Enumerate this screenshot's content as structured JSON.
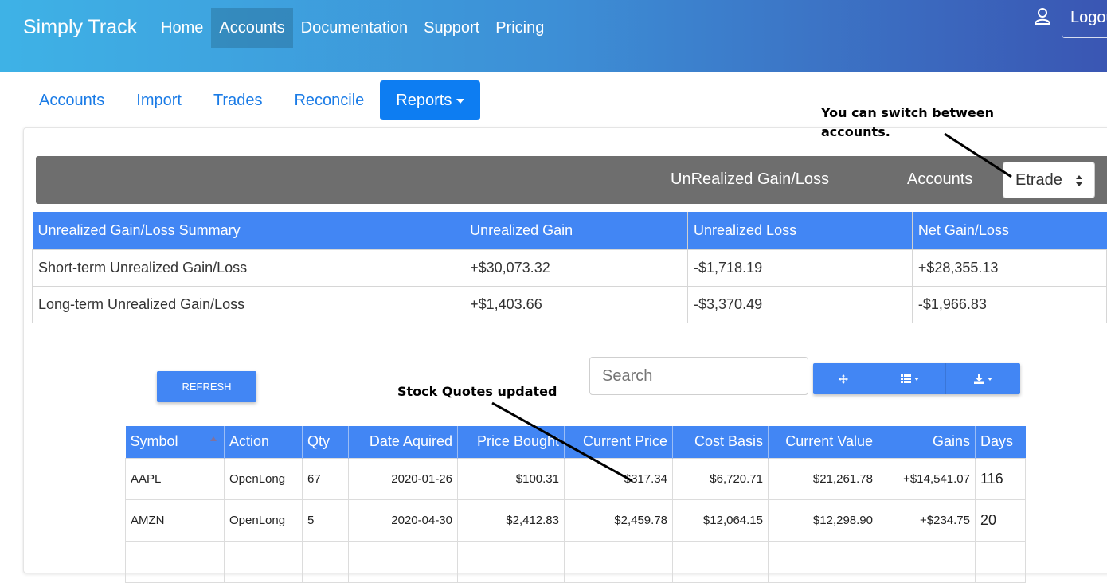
{
  "header": {
    "brand": "Simply Track",
    "nav": [
      {
        "label": "Home",
        "active": false
      },
      {
        "label": "Accounts",
        "active": true
      },
      {
        "label": "Documentation",
        "active": false
      },
      {
        "label": "Support",
        "active": false
      },
      {
        "label": "Pricing",
        "active": false
      }
    ],
    "user_icon": "user-icon",
    "logout_label": "Logout"
  },
  "subnav": {
    "items": [
      "Accounts",
      "Import",
      "Trades",
      "Reconcile"
    ],
    "reports_label": "Reports"
  },
  "annotations": {
    "switch_accounts": "You can switch between accounts.",
    "quotes_updated": "Stock Quotes updated"
  },
  "toolbar": {
    "title": "UnRealized Gain/Loss",
    "accounts_label": "Accounts",
    "account_selected": "Etrade"
  },
  "summary": {
    "headers": [
      "Unrealized Gain/Loss Summary",
      "Unrealized Gain",
      "Unrealized Loss",
      "Net Gain/Loss"
    ],
    "rows": [
      {
        "label": "Short-term Unrealized Gain/Loss",
        "gain": "+$30,073.32",
        "loss": "-$1,718.19",
        "net": "+$28,355.13",
        "net_color": "green"
      },
      {
        "label": "Long-term Unrealized Gain/Loss",
        "gain": "+$1,403.66",
        "loss": "-$3,370.49",
        "net": "-$1,966.83",
        "net_color": "red"
      }
    ]
  },
  "controls": {
    "refresh_label": "REFRESH",
    "search_placeholder": "Search",
    "tool_icons": [
      "move-icon",
      "columns-icon",
      "download-icon"
    ]
  },
  "trades": {
    "headers": [
      "Symbol",
      "Action",
      "Qty",
      "Date Aquired",
      "Price Bought",
      "Current Price",
      "Cost Basis",
      "Current Value",
      "Gains",
      "Days"
    ],
    "rows": [
      {
        "symbol": "AAPL",
        "action": "OpenLong",
        "qty": "67",
        "date": "2020-01-26",
        "price_bought": "$100.31",
        "current_price": "$317.34",
        "cost_basis": "$6,720.71",
        "current_value": "$21,261.78",
        "gains": "+$14,541.07",
        "days": "116"
      },
      {
        "symbol": "AMZN",
        "action": "OpenLong",
        "qty": "5",
        "date": "2020-04-30",
        "price_bought": "$2,412.83",
        "current_price": "$2,459.78",
        "cost_basis": "$12,064.15",
        "current_value": "$12,298.90",
        "gains": "+$234.75",
        "days": "20"
      }
    ]
  },
  "colors": {
    "primary": "#4286f4",
    "gain": "#28a745",
    "loss": "#e23a3a",
    "toolbar_gray": "#6e6e6e"
  }
}
